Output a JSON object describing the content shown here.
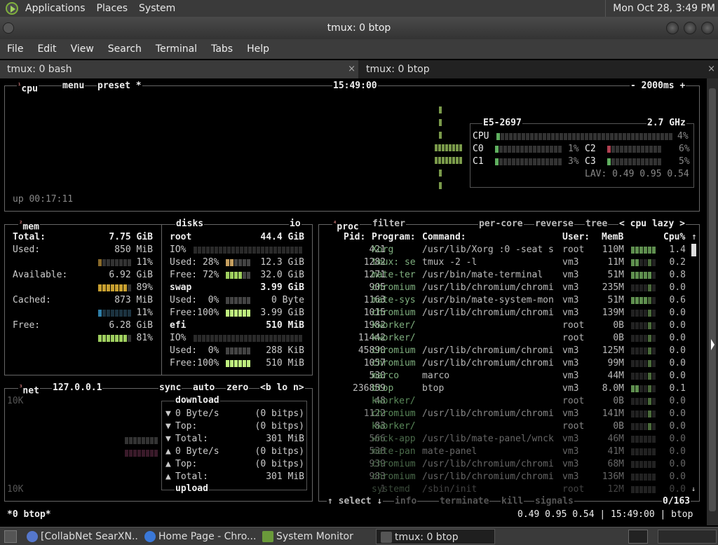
{
  "panel": {
    "apps": "Applications",
    "places": "Places",
    "system": "System",
    "clock": "Mon Oct 28,  3:49 PM"
  },
  "window": {
    "title": "tmux: 0 btop"
  },
  "menu": {
    "items": [
      "File",
      "Edit",
      "View",
      "Search",
      "Terminal",
      "Tabs",
      "Help"
    ]
  },
  "tabs": [
    {
      "label": "tmux: 0 bash",
      "close": "×"
    },
    {
      "label": "tmux: 0 btop",
      "close": "×"
    }
  ],
  "cpu": {
    "num": "¹",
    "title": "cpu",
    "menu": "menu",
    "preset": "preset *",
    "time": "15:49:00",
    "interval": "- 2000ms +",
    "uptime": "up 00:17:11",
    "model": "E5-2697",
    "freq": "2.7 GHz",
    "total": {
      "label": "CPU",
      "pct": "4%",
      "value": 4
    },
    "cores": [
      {
        "label": "C0",
        "pct": "1%"
      },
      {
        "label": "C1",
        "pct": "3%"
      },
      {
        "label": "C2",
        "pct": "6%"
      },
      {
        "label": "C3",
        "pct": "5%"
      }
    ],
    "lav": "LAV: 0.49 0.95 0.54"
  },
  "mem": {
    "num": "²",
    "title": "mem",
    "rows": [
      {
        "label": "Total:",
        "value": "7.75 GiB",
        "pct": ""
      },
      {
        "label": "Used:",
        "value": "850 MiB",
        "pct": "11%",
        "level": 11
      },
      {
        "label": "Available:",
        "value": "6.92 GiB",
        "pct": "89%",
        "level": 89
      },
      {
        "label": "Cached:",
        "value": "873 MiB",
        "pct": "11%",
        "level": 11
      },
      {
        "label": "Free:",
        "value": "6.28 GiB",
        "pct": "81%",
        "level": 81
      }
    ]
  },
  "disks": {
    "title": "disks",
    "io": "io",
    "root": {
      "name": "root",
      "size": "44.4 GiB",
      "io": "IO%",
      "used": "Used: 28%",
      "used_v": "12.3 GiB",
      "free": "Free: 72%",
      "free_v": "32.0 GiB"
    },
    "swap": {
      "name": "swap",
      "size": "3.99 GiB",
      "used": "Used:  0%",
      "used_v": "0 Byte",
      "free": "Free:100%",
      "free_v": "3.99 GiB"
    },
    "efi": {
      "name": "efi",
      "size": "510 MiB",
      "io": "IO%",
      "used": "Used:  0%",
      "used_v": "288 KiB",
      "free": "Free:100%",
      "free_v": "510 MiB"
    }
  },
  "net": {
    "num": "³",
    "title": "net",
    "iface": "127.0.0.1",
    "sync": "sync",
    "auto": "auto",
    "zero": "zero",
    "nav": "<b lo n>",
    "scale_top": "10K",
    "scale_bot": "10K",
    "download": "download",
    "upload": "upload",
    "rows": [
      {
        "arrow": "▼",
        "label": "0 Byte/s",
        "value": "(0 bitps)"
      },
      {
        "arrow": "▼",
        "label": "Top:",
        "value": "(0 bitps)"
      },
      {
        "arrow": "▼",
        "label": "Total:",
        "value": "301 MiB"
      },
      {
        "arrow": "▲",
        "label": "0 Byte/s",
        "value": "(0 bitps)"
      },
      {
        "arrow": "▲",
        "label": "Top:",
        "value": "(0 bitps)"
      },
      {
        "arrow": "▲",
        "label": "Total:",
        "value": "301 MiB"
      }
    ]
  },
  "proc": {
    "num": "⁴",
    "title": "proc",
    "filter": "filter",
    "per_core": "per-core",
    "reverse": "reverse",
    "tree": "tree",
    "sort": "< cpu lazy >",
    "headers": {
      "pid": "Pid:",
      "program": "Program:",
      "command": "Command:",
      "user": "User:",
      "mem": "MemB",
      "cpu": "Cpu%"
    },
    "rows": [
      {
        "pid": "421",
        "prog": "Xorg",
        "cmd": "/usr/lib/Xorg :0 -seat s",
        "user": "root",
        "mem": "110M",
        "cpu": "1.4"
      },
      {
        "pid": "1282",
        "prog": "tmux: se",
        "cmd": "tmux -2 -l",
        "user": "vm3",
        "mem": "11M",
        "cpu": "0.2"
      },
      {
        "pid": "1271",
        "prog": "mate-ter",
        "cmd": "/usr/bin/mate-terminal",
        "user": "vm3",
        "mem": "51M",
        "cpu": "0.8"
      },
      {
        "pid": "905",
        "prog": "chromium",
        "cmd": "/usr/lib/chromium/chromi",
        "user": "vm3",
        "mem": "235M",
        "cpu": "0.0"
      },
      {
        "pid": "1163",
        "prog": "mate-sys",
        "cmd": "/usr/bin/mate-system-mon",
        "user": "vm3",
        "mem": "51M",
        "cpu": "0.6"
      },
      {
        "pid": "1015",
        "prog": "chromium",
        "cmd": "/usr/lib/chromium/chromi",
        "user": "vm3",
        "mem": "139M",
        "cpu": "0.0"
      },
      {
        "pid": "1982",
        "prog": "kworker/",
        "cmd": "",
        "user": "root",
        "mem": "0B",
        "cpu": "0.0"
      },
      {
        "pid": "11442",
        "prog": "kworker/",
        "cmd": "",
        "user": "root",
        "mem": "0B",
        "cpu": "0.0"
      },
      {
        "pid": "45890",
        "prog": "chromium",
        "cmd": "/usr/lib/chromium/chromi",
        "user": "vm3",
        "mem": "125M",
        "cpu": "0.0"
      },
      {
        "pid": "1057",
        "prog": "chromium",
        "cmd": "/usr/lib/chromium/chromi",
        "user": "vm3",
        "mem": "99M",
        "cpu": "0.0"
      },
      {
        "pid": "530",
        "prog": "marco",
        "cmd": "marco",
        "user": "vm3",
        "mem": "44M",
        "cpu": "0.0"
      },
      {
        "pid": "236859",
        "prog": "btop",
        "cmd": "btop",
        "user": "vm3",
        "mem": "8.0M",
        "cpu": "0.1"
      },
      {
        "pid": "48",
        "prog": "kworker/",
        "cmd": "",
        "user": "root",
        "mem": "0B",
        "cpu": "0.0"
      },
      {
        "pid": "1122",
        "prog": "chromium",
        "cmd": "/usr/lib/chromium/chromi",
        "user": "vm3",
        "mem": "141M",
        "cpu": "0.0"
      },
      {
        "pid": "83",
        "prog": "kworker/",
        "cmd": "",
        "user": "root",
        "mem": "0B",
        "cpu": "0.0"
      },
      {
        "pid": "566",
        "prog": "wnck-app",
        "cmd": "/usr/lib/mate-panel/wnck",
        "user": "vm3",
        "mem": "46M",
        "cpu": "0.0"
      },
      {
        "pid": "538",
        "prog": "mate-pan",
        "cmd": "mate-panel",
        "user": "vm3",
        "mem": "41M",
        "cpu": "0.0"
      },
      {
        "pid": "939",
        "prog": "chromium",
        "cmd": "/usr/lib/chromium/chromi",
        "user": "vm3",
        "mem": "68M",
        "cpu": "0.0"
      },
      {
        "pid": "983",
        "prog": "chromium",
        "cmd": "/usr/lib/chromium/chromi",
        "user": "vm3",
        "mem": "136M",
        "cpu": "0.0"
      },
      {
        "pid": "1",
        "prog": "systemd",
        "cmd": "/sbin/init",
        "user": "root",
        "mem": "12M",
        "cpu": "0.0"
      }
    ],
    "footer": {
      "select": "↑ select ↓",
      "info": "info",
      "terminate": "terminate",
      "kill": "kill",
      "signals": "signals",
      "count": "0/163"
    }
  },
  "status": {
    "left": "*0 btop*",
    "right": "0.49 0.95 0.54 | 15:49:00 | btop"
  },
  "taskbar": [
    {
      "label": "[CollabNet SearXN...",
      "color": "#5577cc"
    },
    {
      "label": "Home Page - Chro...",
      "color": "#3a78d8"
    },
    {
      "label": "System Monitor",
      "color": "#6a9a3a"
    },
    {
      "label": "tmux: 0 btop",
      "color": "#555555"
    }
  ],
  "colors": {
    "accent": "#7fb03c",
    "green": "#5faf5f",
    "yellow": "#c8a030",
    "cyan": "#2f7fa8",
    "red": "#b04050"
  }
}
